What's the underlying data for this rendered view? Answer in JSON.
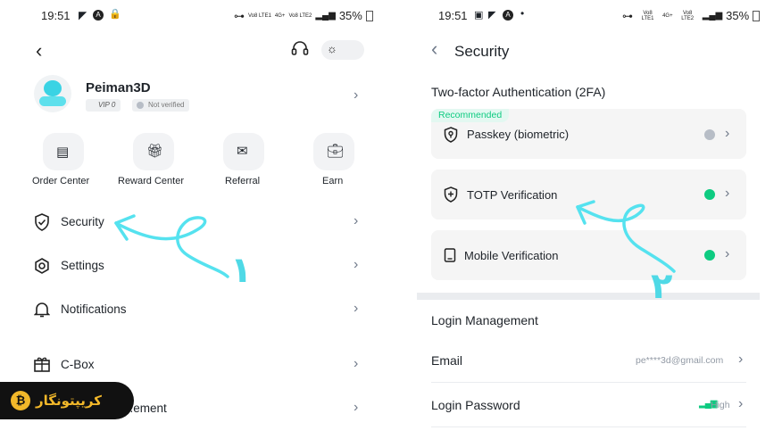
{
  "left": {
    "status": {
      "time": "19:51",
      "network": "Vo8 LTE1",
      "net2": "4G+",
      "net3": "Vo8 LTE2",
      "battery": "35%"
    },
    "profile": {
      "username": "Peiman3D",
      "vip": "VIP 0",
      "verify": "Not verified"
    },
    "shortcuts": [
      {
        "label": "Order Center"
      },
      {
        "label": "Reward Center"
      },
      {
        "label": "Referral"
      },
      {
        "label": "Earn"
      }
    ],
    "menu": [
      {
        "label": "Security"
      },
      {
        "label": "Settings"
      },
      {
        "label": "Notifications"
      },
      {
        "label": "C-Box"
      },
      {
        "label": "...ement"
      }
    ],
    "annotation": "١",
    "watermark": "کریپتونگار"
  },
  "right": {
    "status": {
      "time": "19:51",
      "network": "Vo8 LTE1",
      "net2": "4G+",
      "net3": "Vo8 LTE2",
      "battery": "35%"
    },
    "header": {
      "title": "Security"
    },
    "twofa": {
      "heading": "Two-factor Authentication (2FA)",
      "recommended": "Recommended",
      "items": [
        {
          "label": "Passkey (biometric)",
          "status_color": "#b7bdc6"
        },
        {
          "label": "TOTP Verification",
          "status_color": "#0ecb81"
        },
        {
          "label": "Mobile Verification",
          "status_color": "#0ecb81"
        }
      ]
    },
    "login": {
      "heading": "Login Management",
      "email_label": "Email",
      "email_value": "pe****3d@gmail.com",
      "password_label": "Login Password",
      "password_value": "High"
    },
    "annotation": "٢"
  }
}
